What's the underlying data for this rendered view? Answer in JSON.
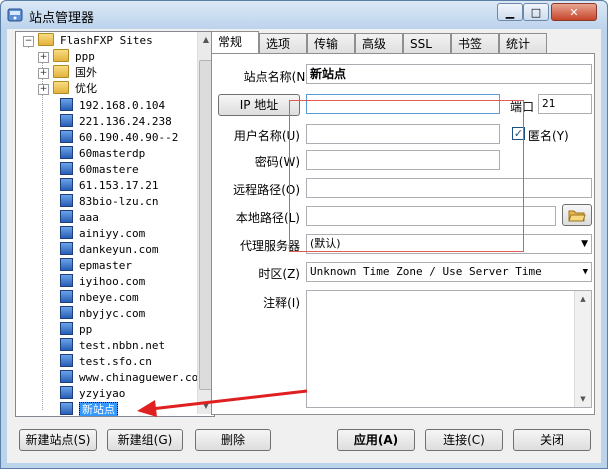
{
  "window": {
    "title": "站点管理器"
  },
  "tree": {
    "root": "FlashFXP Sites",
    "folders": [
      "ppp",
      "国外",
      "优化"
    ],
    "sites": [
      "192.168.0.104",
      "221.136.24.238",
      "60.190.40.90--2",
      "60masterdp",
      "60mastere",
      "61.153.17.21",
      "83bio-lzu.cn",
      "aaa",
      "ainiyy.com",
      "dankeyun.com",
      "epmaster",
      "iyihoo.com",
      "nbeye.com",
      "nbyjyc.com",
      "pp",
      "test.nbbn.net",
      "test.sfo.cn",
      "www.chinaguewer.com",
      "yzyiyao"
    ],
    "selected": "新站点"
  },
  "tabs": [
    "常规",
    "选项",
    "传输",
    "高级",
    "SSL",
    "书签",
    "统计"
  ],
  "form": {
    "site_name_label": "站点名称",
    "site_name_key": "(N)",
    "site_name_value": "新站点",
    "ip_button": "IP 地址",
    "ip_value": "",
    "port_label": "端口",
    "port_value": "21",
    "username_label": "用户名称",
    "username_key": "(U)",
    "username_value": "",
    "anonymous_label": "匿名",
    "anonymous_key": "(Y)",
    "anonymous_checked": "✓",
    "password_label": "密码",
    "password_key": "(W)",
    "password_value": "",
    "remote_label": "远程路径",
    "remote_key": "(O)",
    "remote_value": "",
    "local_label": "本地路径",
    "local_key": "(L)",
    "local_value": "",
    "proxy_label": "代理服务器",
    "proxy_value": "(默认)",
    "tz_label": "时区",
    "tz_key": "(Z)",
    "tz_value": "Unknown Time Zone / Use Server Time",
    "notes_label": "注释",
    "notes_key": "(I)"
  },
  "buttons": {
    "new_site": "新建站点(S)",
    "new_group": "新建组(G)",
    "delete": "删除",
    "apply": "应用(A)",
    "connect": "连接(C)",
    "close": "关闭"
  },
  "colors": {
    "annotation": "#e02020",
    "selection": "#3399ff"
  }
}
